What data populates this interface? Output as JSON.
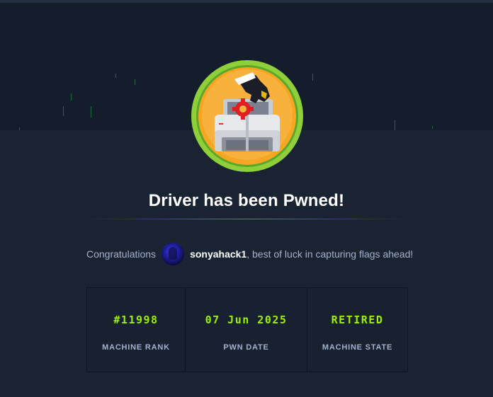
{
  "machine": {
    "title": "Driver has been Pwned!",
    "badge_icon": "printer-pwned-badge-icon"
  },
  "congrats": {
    "prefix": "Congratulations",
    "username": "sonyahack1",
    "suffix": ", best of luck in capturing flags ahead!"
  },
  "stats": [
    {
      "value": "#11998",
      "label": "MACHINE RANK"
    },
    {
      "value": "07 Jun 2025",
      "label": "PWN DATE"
    },
    {
      "value": "RETIRED",
      "label": "MACHINE STATE"
    }
  ],
  "colors": {
    "accent": "#9fef00",
    "background": "#1a2332",
    "banner": "#141d2b",
    "muted_text": "#a4b1cd"
  }
}
